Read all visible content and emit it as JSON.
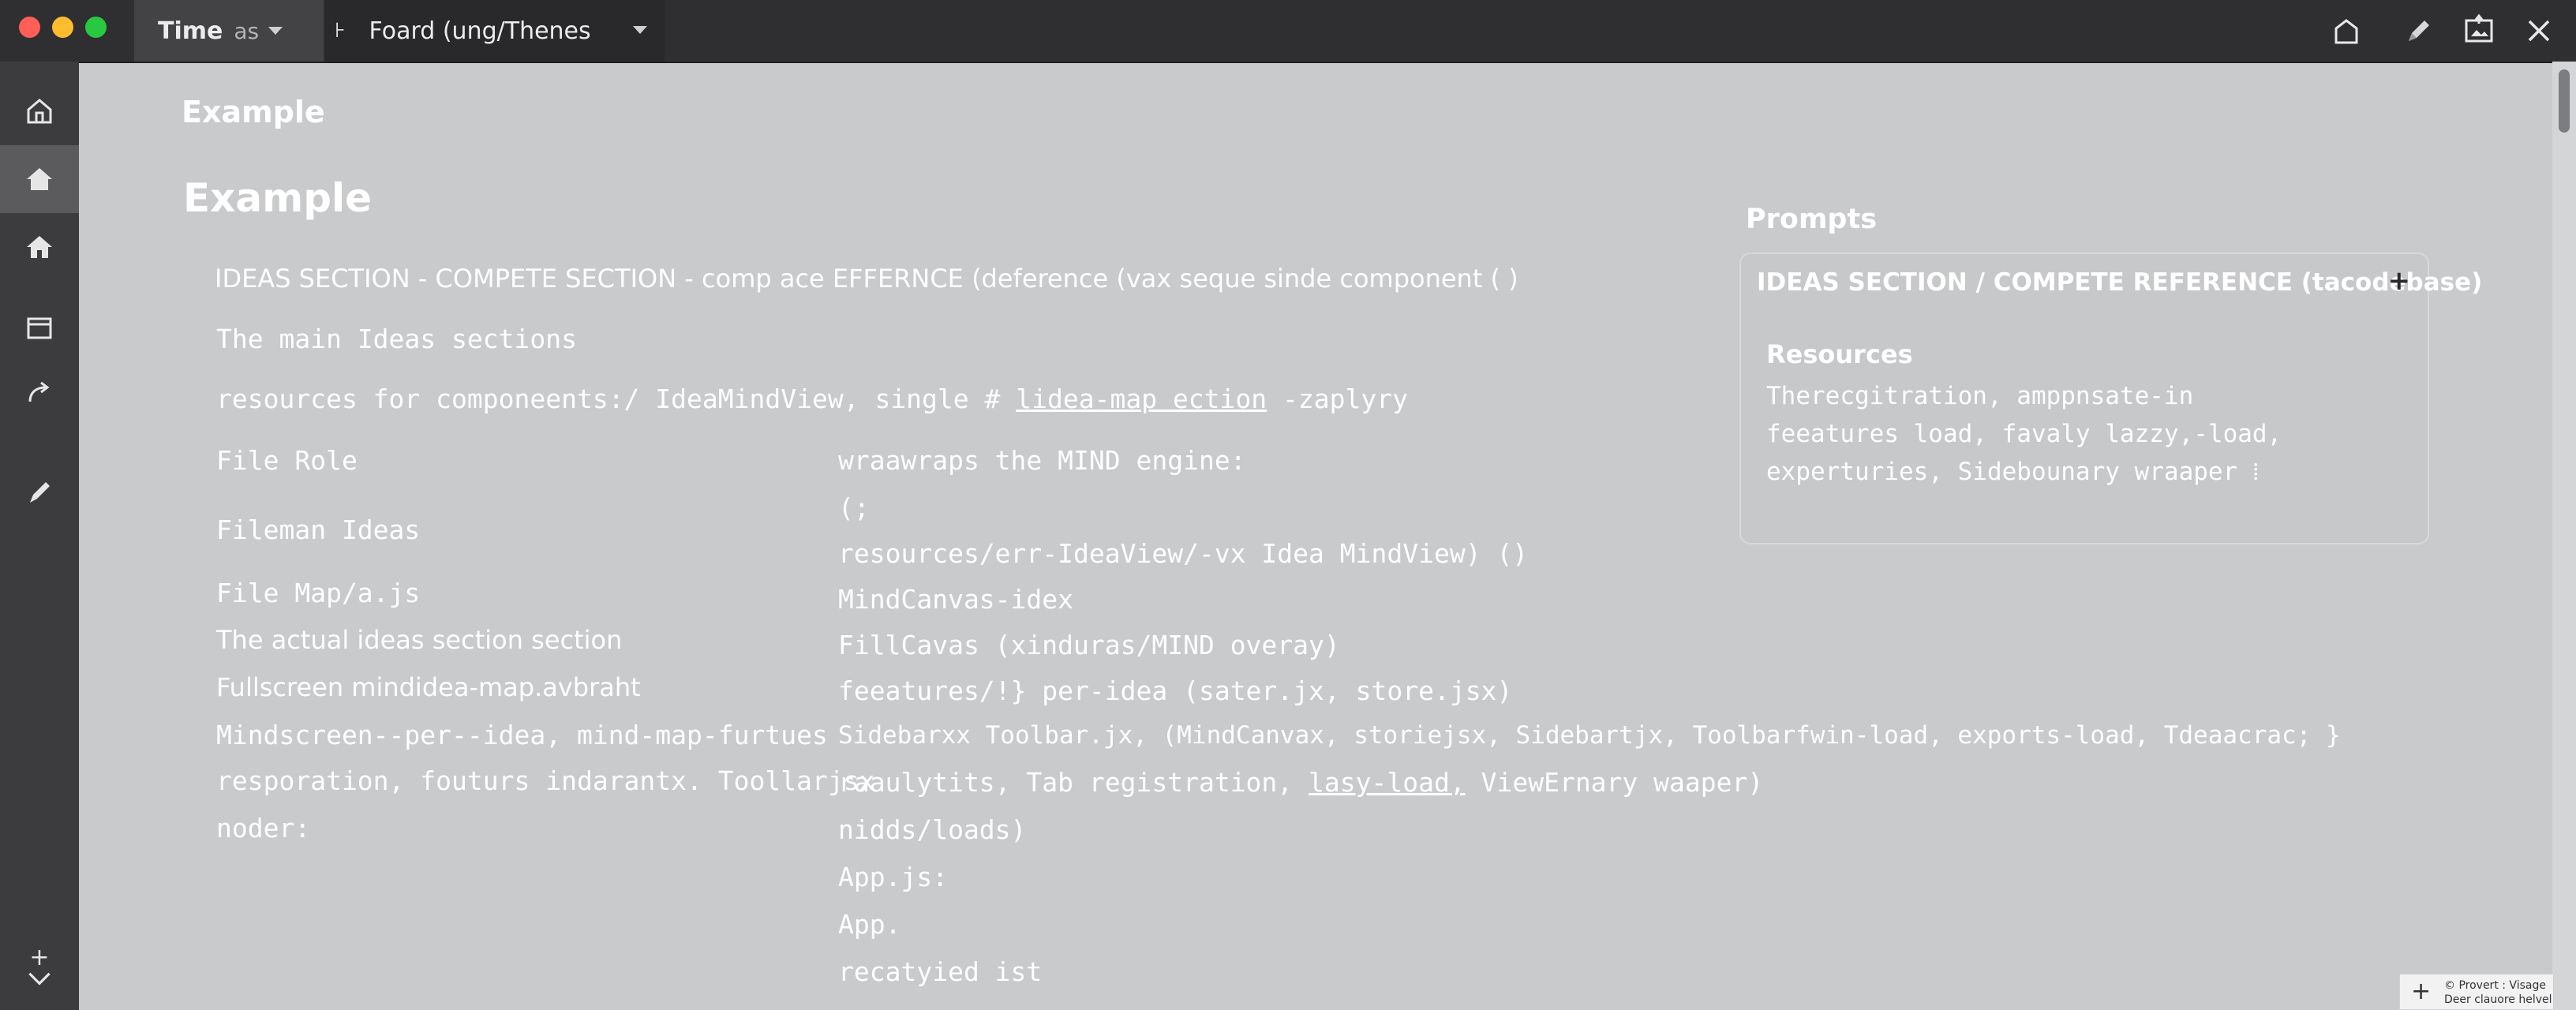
{
  "titlebar": {
    "tab1": {
      "strong": "Time",
      "muted": "as"
    },
    "tab2": {
      "mark": "⊦",
      "label": "Foard (ung/Thenes"
    },
    "icons": [
      "share-icon",
      "pen-icon",
      "image-icon",
      "close-icon"
    ]
  },
  "rail": {
    "items": [
      "home-outline-icon",
      "home-icon",
      "home-icon",
      "archive-icon",
      "share-arrow-icon",
      "pen-icon"
    ],
    "active_index": 1,
    "bottom_plus": "+",
    "bottom_chevron": "chevron-down-icon"
  },
  "main": {
    "heading_small": "Example",
    "heading_big": "Example",
    "line1": "IDEAS SECTION - COMPETE SECTION - comp ace EFFERNCE (deference (vax seque sinde component (  )",
    "line2": "The main Ideas sections",
    "line3_prefix": "resources for componeents:/ IdeaMindView, single #",
    "line3_link": "lidea-map ection",
    "line3_suffix": "-zaplyry",
    "left_column": [
      "File Role",
      "Fileman Ideas",
      "File Map/a.js",
      "The actual ideas section section",
      "Fullscreen mindidea-map.avbraht",
      "Mindscreen--per--idea,  mind-map-furtues",
      "resporation, fouturs indarantx. Toollarjsx",
      "noder:"
    ],
    "right_column": [
      "wraawraps the MIND engine:",
      "(;",
      "resources/err-IdeaView/-vx Idea MindView) ()",
      "MindCanvas-idex",
      "FillCavas (xinduras/MIND overay)",
      "feeatures/!} per-idea (sater.jx, store.jsx)",
      "Sidebarxx Toolbar.jx, (MindCanvax, storiejsx, Sidebartjx, Toolbarfwin-load, exports-load, Tdeaacrac; }",
      "raaulytits, Tab registration,",
      "nidds/loads)",
      "App.js:",
      "App.",
      "recatyied ist"
    ],
    "right_row8_link": "lasy-load,",
    "right_row8_suffix": "ViewErnary waaper)"
  },
  "prompts": {
    "title": "Prompts",
    "card_title": "IDEAS SECTION / COMPETE REFERENCE (tacodebase)",
    "card_plus": "+",
    "resources_title": "Resources",
    "body": [
      "Therecgitration, amppnsate-in",
      "feeatures load, favaly lazzy,-load,",
      "experturies, Sidebounary wraaper  ⁞"
    ]
  },
  "notice": {
    "plus": "+",
    "line1": "© Provert : Visage",
    "line2": "Deer clauore helvel"
  },
  "colors": {
    "background": "#c9cacc",
    "titlebar": "#2f2f31",
    "rail": "#3c3c3e",
    "text": "#ffffff"
  }
}
